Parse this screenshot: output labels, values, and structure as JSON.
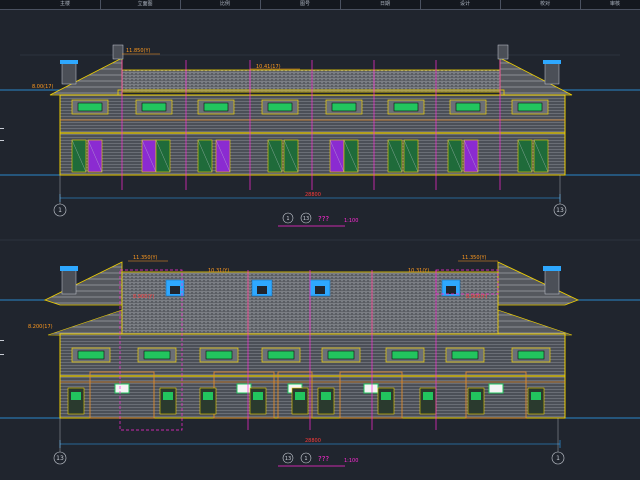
{
  "header": {
    "columns": [
      "主楼",
      "立面图",
      "比例",
      "图号",
      "日期",
      "设计",
      "校对",
      "审核"
    ]
  },
  "elevation_top": {
    "dims": {
      "ridge_left": "11.850(Y)",
      "ridge_mid": "10.41(17)",
      "eave_left": "8.00(17)",
      "overall_width": "28800"
    },
    "axis_left": "1",
    "axis_right": "13",
    "title_symbols": [
      "1",
      "13"
    ],
    "title_text": "???",
    "title_scale": "1:100"
  },
  "elevation_bottom": {
    "dims": {
      "ridge_left": "11.350(Y)",
      "ridge_right": "11.350(Y)",
      "ridge_mid_left": "10.31(Y)",
      "ridge_mid_right": "10.31(Y)",
      "dormer_left": "8.900(Y)",
      "dormer_right": "8.900(Y)",
      "eave_left": "8.200(17)",
      "overall_width": "28800"
    },
    "axis_left": "13",
    "axis_right": "1",
    "title_symbols": [
      "13",
      "1"
    ],
    "title_text": "???",
    "title_scale": "1:100"
  },
  "colors": {
    "background": "#20252e",
    "wall_yellow": "#f0d000",
    "roof_gray": "#8e8e8e",
    "magenta_line": "#ff2bd6",
    "cyan_axis": "#2ea8ff",
    "green_window": "#22c55e",
    "purple_door": "#8b2bd1",
    "label_red": "#ff3b3b",
    "label_orange": "#ff9a1f"
  }
}
